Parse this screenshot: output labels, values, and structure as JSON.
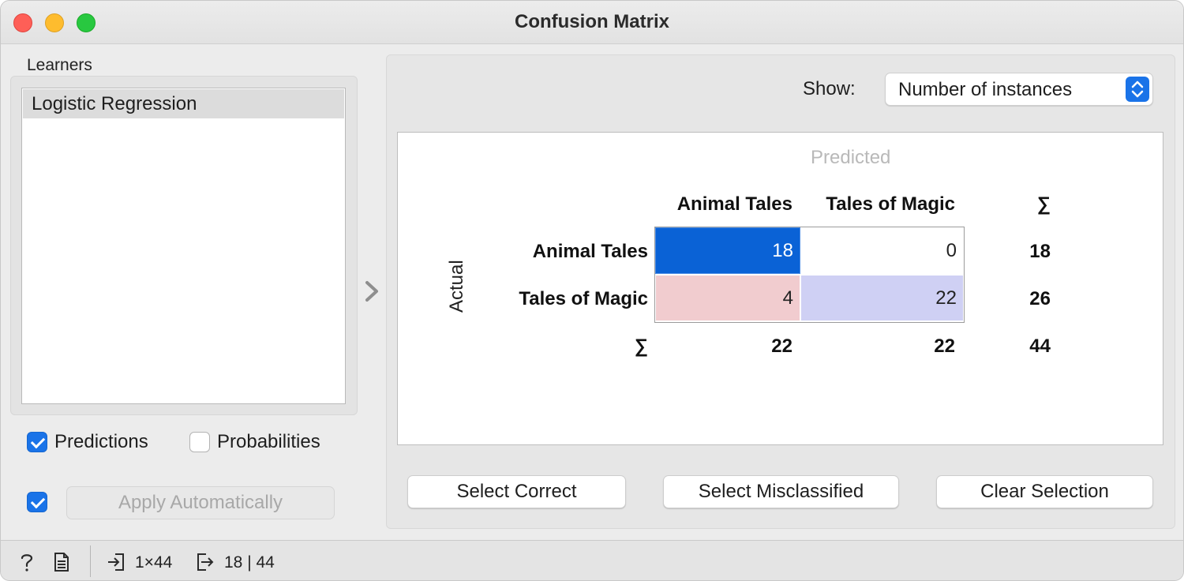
{
  "window": {
    "title": "Confusion Matrix"
  },
  "learners": {
    "label": "Learners",
    "items": [
      "Logistic Regression"
    ],
    "selected_index": 0
  },
  "options": {
    "predictions_label": "Predictions",
    "predictions_checked": true,
    "probabilities_label": "Probabilities",
    "probabilities_checked": false,
    "auto_apply_checked": true,
    "apply_label": "Apply Automatically"
  },
  "show": {
    "label": "Show:",
    "value": "Number of instances"
  },
  "matrix": {
    "predicted_label": "Predicted",
    "actual_label": "Actual",
    "sum_symbol": "∑",
    "columns": [
      "Animal Tales",
      "Tales of Magic"
    ],
    "rows": [
      {
        "label": "Animal Tales",
        "values": [
          "18",
          "0"
        ],
        "total": "18"
      },
      {
        "label": "Tales of Magic",
        "values": [
          "4",
          "22"
        ],
        "total": "26"
      }
    ],
    "column_totals": [
      "22",
      "22"
    ],
    "grand_total": "44",
    "cell_colors": {
      "selected": "#0a62d6",
      "misclassified": "#f1cccf",
      "correct": "#cfd0f4",
      "empty": "#ffffff"
    }
  },
  "buttons": {
    "select_correct": "Select Correct",
    "select_misclassified": "Select Misclassified",
    "clear_selection": "Clear Selection"
  },
  "status": {
    "input_summary": "1×44",
    "output_summary": "18 | 44"
  },
  "icons": {
    "help": "help-icon",
    "report": "report-icon",
    "input": "input-icon",
    "output": "output-icon",
    "collapse": "chevron-right-icon"
  }
}
